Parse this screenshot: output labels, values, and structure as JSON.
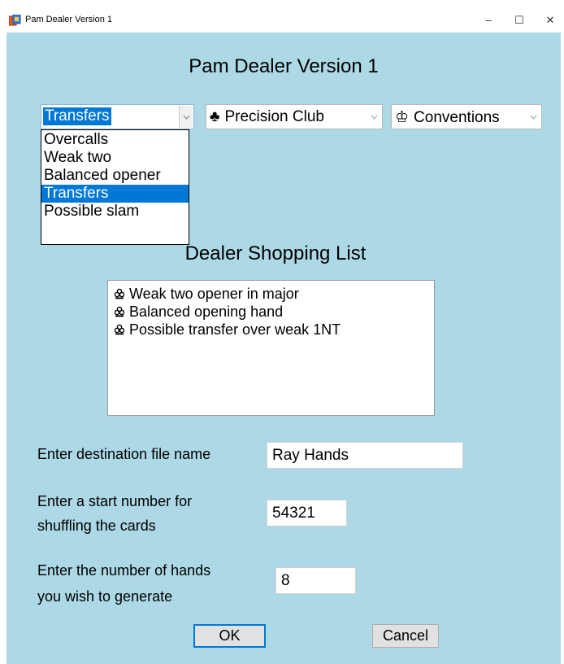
{
  "window": {
    "title": "Pam Dealer Version 1",
    "minimize_glyph": "–",
    "maximize_glyph": "☐",
    "close_glyph": "✕"
  },
  "heading": "Pam Dealer Version 1",
  "combos": {
    "category": {
      "value": "Transfers"
    },
    "system": {
      "symbol": "♣",
      "value": "Precision Club"
    },
    "conventions": {
      "symbol": "♔",
      "value": "Conventions"
    }
  },
  "dropdown": {
    "items": [
      "Overcalls",
      "Weak two",
      "Balanced opener",
      "Transfers",
      "Possible slam"
    ],
    "selected": "Transfers"
  },
  "shopping_list": {
    "title": "Dealer Shopping List",
    "items": [
      "Weak two opener in major",
      "Balanced opening hand",
      "Possible transfer over weak 1NT"
    ]
  },
  "form": {
    "dest_label": "Enter destination file name",
    "dest_value": "Ray Hands",
    "start_label_line1": "Enter a start number for",
    "start_label_line2": "shuffling the cards",
    "start_value": "54321",
    "hands_label_line1": "Enter the number of hands",
    "hands_label_line2": "you wish to generate",
    "hands_value": "8"
  },
  "buttons": {
    "ok": "OK",
    "cancel": "Cancel"
  },
  "colors": {
    "client_bg": "#add8e6",
    "selection": "#0078d7"
  },
  "icons": {
    "app": "cards-app-icon",
    "list_bullet": "club-bullet-icon",
    "combo_arrow": "chevron-down-icon"
  }
}
